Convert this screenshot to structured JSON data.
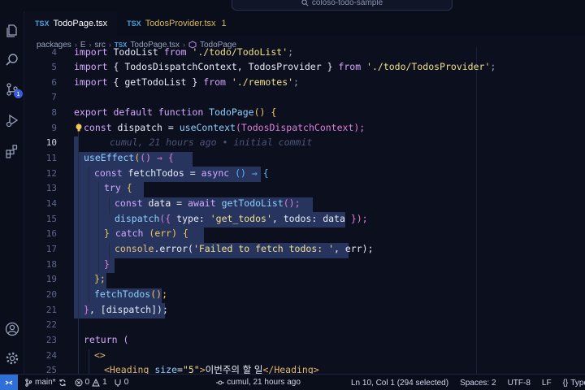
{
  "window": {
    "title": "coloso-todo-sample"
  },
  "tabs": [
    {
      "icon": "TSX",
      "label": "TodoPage.tsx",
      "active": true
    },
    {
      "icon": "TSX",
      "label": "TodosProvider.tsx",
      "count": "1",
      "active": false
    }
  ],
  "breadcrumb": {
    "packages": "packages",
    "e": "E",
    "src": "src",
    "file_icon": "TSX",
    "file": "TodoPage.tsx",
    "symbol": "TodoPage"
  },
  "editor": {
    "line_numbers": [
      "4",
      "5",
      "6",
      "7",
      "8",
      "9",
      "10",
      "11",
      "12",
      "13",
      "14",
      "15",
      "16",
      "17",
      "18",
      "19",
      "20",
      "21",
      "22",
      "23",
      "24",
      "25"
    ],
    "blame": "cumul, 21 hours ago • initial commit",
    "lines": {
      "l4": [
        "import",
        " TodoList ",
        "from",
        " './todo/TodoList'",
        ";"
      ],
      "l5a": "import",
      "l5b": " { TodosDispatchContext, TodosProvider } ",
      "l5c": "from",
      "l5d": " './todo/TodosProvider'",
      "l5e": ";",
      "l6a": "import",
      "l6b": " { getTodoList } ",
      "l6c": "from",
      "l6d": " './remotes'",
      "l6e": ";",
      "l8a": "export default function",
      "l8b": " TodoPage",
      "l8c": "() {",
      "l9a": "const",
      "l9b": " dispatch = ",
      "l9c": "useContext",
      "l9d": "(TodosDispatchContext);",
      "l11a": "useEffect",
      "l11b": "(",
      "l11c": "() ⇒ {",
      "l12a": "const",
      "l12b": " fetchTodos = ",
      "l12c": "async",
      "l12d": " () ⇒ {",
      "l13a": "try",
      "l13b": " {",
      "l14a": "const",
      "l14b": " data",
      "l14c": " = ",
      "l14d": "await",
      "l14e": " getTodoList",
      "l14f": "();",
      "l15a": "dispatch",
      "l15b": "({",
      "l15c": " type: ",
      "l15d": "'get_todos'",
      "l15e": ", todos: data ",
      "l15f": "});",
      "l16a": "}",
      "l16b": " catch",
      "l16c": " (err) {",
      "l17a": "console",
      "l17b": ".error(",
      "l17c": "'Failed to fetch todos: '",
      "l17d": ", err);",
      "l18": "}",
      "l19": "};",
      "l20a": "fetchTodos",
      "l20b": "();",
      "l21a": "}",
      "l21b": ", [dispatch]);",
      "l23": "return (",
      "l24": "<>",
      "l25a": "<Heading",
      "l25b": " size",
      "l25c": "=",
      "l25d": "\"5\"",
      "l25e": ">",
      "l25f": "이번주의 할 일",
      "l25g": "</Heading>"
    }
  },
  "status": {
    "branch": "main*",
    "errors": "0",
    "warnings": "1",
    "ports": "0",
    "blame": "cumul, 21 hours ago",
    "position": "Ln 10, Col 1 (294 selected)",
    "spaces": "Spaces: 2",
    "encoding": "UTF-8",
    "eol": "LF",
    "braces": "{}",
    "language": "Type"
  },
  "activity": {
    "scm_badge": "1"
  },
  "colors": {
    "accent": "#2f6fd8",
    "selection": "#26345e",
    "background": "#0b0f1e"
  }
}
